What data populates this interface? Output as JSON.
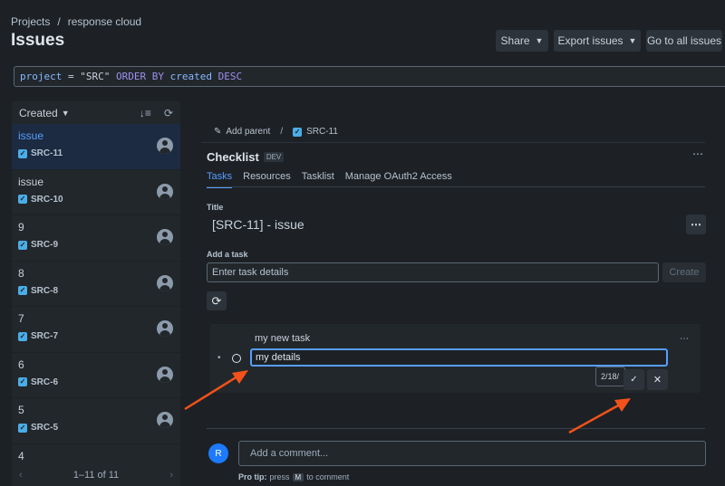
{
  "header": {
    "crumb_projects": "Projects",
    "crumb_sep": "/",
    "crumb_project": "response cloud",
    "title": "Issues",
    "share_label": "Share",
    "export_label": "Export issues",
    "goto_label": "Go to all issues"
  },
  "jql": {
    "field": "project",
    "op": "=",
    "value": "\"SRC\"",
    "order": "ORDER BY",
    "sort_field": "created",
    "dir": "DESC"
  },
  "list": {
    "sort_label": "Created",
    "items": [
      {
        "summary": "issue",
        "key": "SRC-11"
      },
      {
        "summary": "issue",
        "key": "SRC-10"
      },
      {
        "summary": "9",
        "key": "SRC-9"
      },
      {
        "summary": "8",
        "key": "SRC-8"
      },
      {
        "summary": "7",
        "key": "SRC-7"
      },
      {
        "summary": "6",
        "key": "SRC-6"
      },
      {
        "summary": "5",
        "key": "SRC-5"
      },
      {
        "summary": "4",
        "key": ""
      }
    ],
    "pager": "1–11 of 11"
  },
  "detail": {
    "add_parent": "Add parent",
    "issue_key": "SRC-11",
    "app_title": "Checklist",
    "badge": "DEV",
    "tabs": [
      "Tasks",
      "Resources",
      "Tasklist",
      "Manage OAuth2 Access"
    ],
    "title_label": "Title",
    "title_value": "[SRC-11] - issue",
    "add_task_label": "Add a task",
    "task_placeholder": "Enter task details",
    "create_label": "Create",
    "task_name": "my new task",
    "task_details_value": "my details",
    "date_value": "2/18/",
    "comment_avatar": "R",
    "comment_placeholder": "Add a comment...",
    "protip_bold": "Pro tip:",
    "protip_press": "press",
    "protip_key": "M",
    "protip_rest": "to comment"
  },
  "colors": {
    "background": "#1d2125",
    "accent": "#579dff",
    "annotation_arrow": "#f2521a"
  },
  "icons": [
    "chevron-down-icon",
    "sort-icon",
    "refresh-icon",
    "checkbox-icon",
    "avatar-icon",
    "pencil-icon",
    "more-icon",
    "sync-icon",
    "check-icon",
    "close-icon"
  ]
}
